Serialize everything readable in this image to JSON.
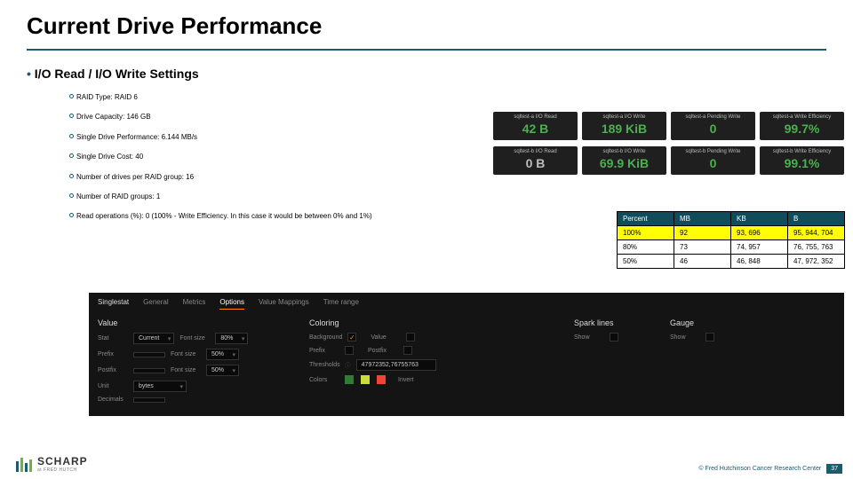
{
  "title": "Current Drive Performance",
  "subtitle": "I/O Read / I/O Write Settings",
  "specs": [
    "RAID Type: RAID 6",
    "Drive Capacity: 146 GB",
    "Single Drive Performance: 6.144 MB/s",
    "Single Drive Cost: 40",
    "Number of drives per RAID group: 16",
    "Number of RAID groups: 1",
    "Read operations (%): 0 (100% - Write Efficiency. In this case it would be between 0% and 1%)"
  ],
  "metrics": {
    "rowA": [
      {
        "label": "sqltest-a I/O Read",
        "value": "42 B"
      },
      {
        "label": "sqltest-a I/O Write",
        "value": "189 KiB"
      },
      {
        "label": "sqltest-a Pending Write",
        "value": "0"
      },
      {
        "label": "sqltest-a Write Efficiency",
        "value": "99.7%"
      }
    ],
    "rowB": [
      {
        "label": "sqltest-b I/O Read",
        "value": "0 B"
      },
      {
        "label": "sqltest-b I/O Write",
        "value": "69.9 KiB"
      },
      {
        "label": "sqltest-b Pending Write",
        "value": "0"
      },
      {
        "label": "sqltest-b Write Efficiency",
        "value": "99.1%"
      }
    ]
  },
  "conv": {
    "headers": [
      "Percent",
      "MB",
      "KB",
      "B"
    ],
    "rows": [
      {
        "hl": true,
        "c": [
          "100%",
          "92",
          "93, 696",
          "95, 944, 704"
        ]
      },
      {
        "hl": false,
        "c": [
          "80%",
          "73",
          "74, 957",
          "76, 755, 763"
        ]
      },
      {
        "hl": false,
        "c": [
          "50%",
          "46",
          "46, 848",
          "47, 972, 352"
        ]
      }
    ]
  },
  "panel": {
    "name": "Singlestat",
    "tabs": [
      "General",
      "Metrics",
      "Options",
      "Value Mappings",
      "Time range"
    ],
    "active": 2,
    "value": {
      "stat": "Current",
      "fs1": "80%",
      "prefix": "",
      "fs2": "50%",
      "postfix": "",
      "fs3": "50%",
      "unit": "bytes",
      "decimals": ""
    },
    "coloring": {
      "background": true,
      "value": false,
      "prefix": false,
      "postfix": false,
      "thresholds": "47972352,76755763",
      "colors": [
        "#2e7d32",
        "#cddc39",
        "#f44336"
      ],
      "invert": "Invert"
    },
    "spark": {
      "show": false
    },
    "gauge": {
      "show": false
    }
  },
  "footer": {
    "copy": "© Fred Hutchinson Cancer Research Center",
    "page": "37"
  },
  "logo": {
    "name": "SCHARP",
    "sub": "at FRED HUTCH"
  }
}
